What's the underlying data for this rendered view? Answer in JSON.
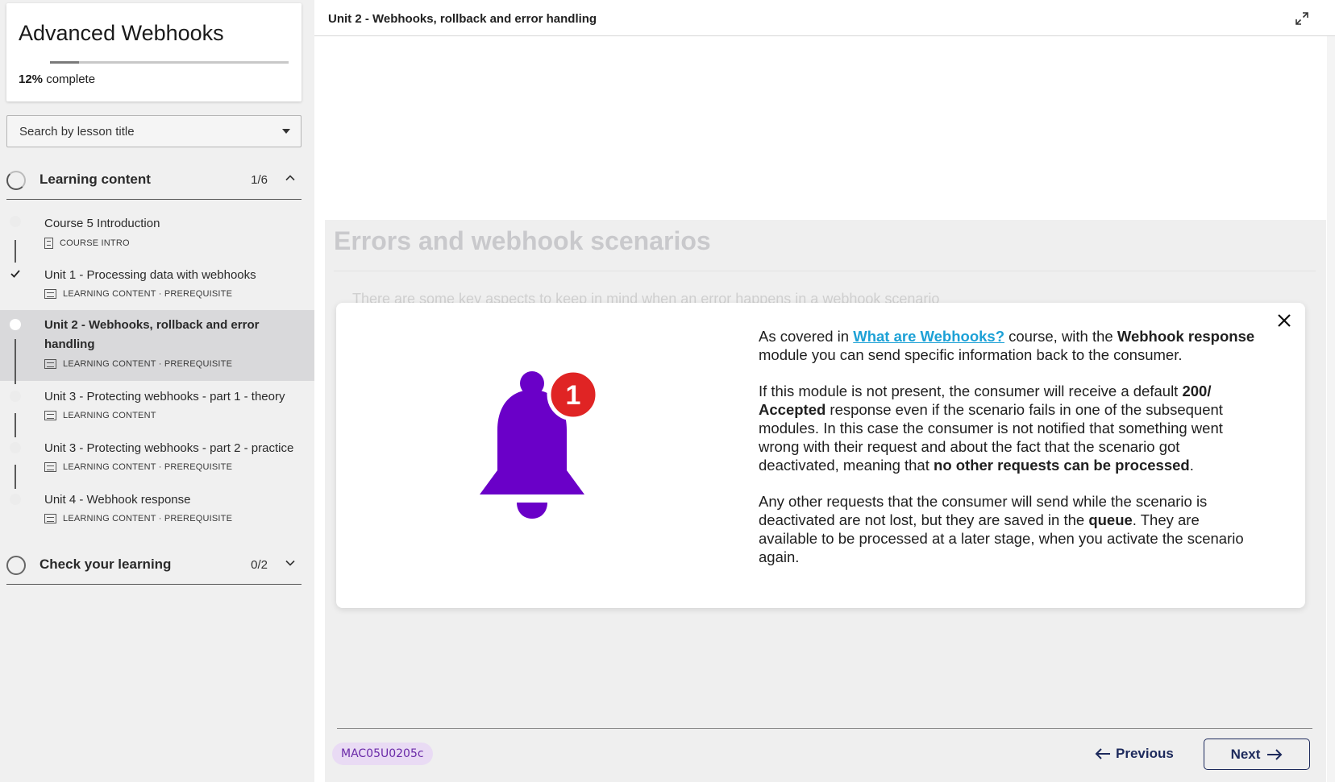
{
  "sidebar": {
    "course_title": "Advanced Webhooks",
    "progress": {
      "percent_label": "12%",
      "suffix": "complete",
      "fraction": 0.12
    },
    "search_placeholder": "Search by lesson title",
    "sections": [
      {
        "label": "Learning content",
        "count": "1/6",
        "expanded": true,
        "lessons": [
          {
            "title": "Course 5 Introduction",
            "meta": "COURSE INTRO",
            "status": "incomplete"
          },
          {
            "title": "Unit 1 - Processing data with webhooks",
            "meta": "LEARNING CONTENT · PREREQUISITE",
            "status": "done"
          },
          {
            "title": "Unit 2 - Webhooks, rollback and error handling",
            "meta": "LEARNING CONTENT · PREREQUISITE",
            "status": "current"
          },
          {
            "title": "Unit 3 - Protecting webhooks - part 1 - theory",
            "meta": "LEARNING CONTENT",
            "status": "incomplete"
          },
          {
            "title": "Unit 3 - Protecting webhooks - part 2 - practice",
            "meta": "LEARNING CONTENT · PREREQUISITE",
            "status": "incomplete"
          },
          {
            "title": "Unit 4 - Webhook response",
            "meta": "LEARNING CONTENT · PREREQUISITE",
            "status": "incomplete"
          }
        ]
      },
      {
        "label": "Check your learning",
        "count": "0/2",
        "expanded": false
      }
    ]
  },
  "main": {
    "unit_title": "Unit 2 - Webhooks, rollback and error handling",
    "faded_heading": "Errors and webhook scenarios",
    "faded_text": "There are some key aspects to keep in mind when an error happens in a webhook scenario",
    "modal": {
      "notification_count": "1",
      "p1_before": "As covered in ",
      "p1_link": "What are Webhooks?",
      "p1_mid": " course, with the ",
      "p1_bold": "Webhook response",
      "p1_after": " module you can send specific information back to the consumer.",
      "p2_before": "If this module is not present, the consumer will receive a default ",
      "p2_bold1": "200/ Accepted",
      "p2_mid": " response even if the scenario fails in one of the subsequent modules. In this case the consumer is not notified that something went wrong with their request and about the fact that the scenario got deactivated, meaning that ",
      "p2_bold2": "no other requests can be processed",
      "p2_after": ".",
      "p3_before": "Any other requests that the consumer will send while the scenario is deactivated are not lost, but they are saved in the ",
      "p3_bold": "queue",
      "p3_after": ". They are available to be processed at a later stage, when you activate the scenario again."
    },
    "footer": {
      "code": "MAC05U0205c",
      "previous_label": "Previous",
      "next_label": "Next"
    }
  },
  "colors": {
    "bell": "#6a00c8",
    "badge": "#e02424",
    "link": "#1da1d6",
    "nav": "#1d2a5c"
  }
}
